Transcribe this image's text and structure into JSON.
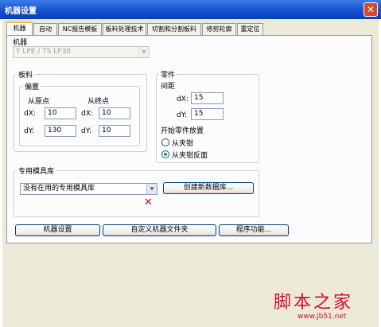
{
  "window": {
    "title": "机器设置",
    "close": "✕"
  },
  "tabs": [
    {
      "label": "机器",
      "active": true
    },
    {
      "label": "自动"
    },
    {
      "label": "NC报告模板"
    },
    {
      "label": "板料处理技术"
    },
    {
      "label": "切割和分割板料"
    },
    {
      "label": "修剪轮廓"
    },
    {
      "label": "重定位"
    }
  ],
  "machine": {
    "label": "机器",
    "value": "Y LPE / TS        LF30"
  },
  "sheet": {
    "group_label": "板料",
    "offset": {
      "group_label": "偏置",
      "origin_label": "从原点",
      "end_label": "从终点",
      "dx_label": "dX:",
      "dy_label": "dY:",
      "origin_dx": "10",
      "origin_dy": "130",
      "end_dx": "10",
      "end_dy": "10"
    }
  },
  "part": {
    "group_label": "零件",
    "spacing_label": "间距",
    "dx_label": "dX:",
    "dy_label": "dY:",
    "dx": "15",
    "dy": "15",
    "start_label": "开始零件放置",
    "options": [
      {
        "label": "从夹钳",
        "selected": false
      },
      {
        "label": "从夹钳反面",
        "selected": true
      }
    ]
  },
  "toolbase": {
    "group_label": "专用模具库",
    "select_value": "没有在用的专用模具库",
    "create_button": "创建新数据库...",
    "delete_icon": "✕"
  },
  "buttons": {
    "machine_settings": "机器设置",
    "custom_folder": "自定义机器文件夹",
    "program_functions": "程序功能..."
  },
  "watermark": {
    "brand": "脚本之家",
    "url": "www.jb51.net"
  }
}
